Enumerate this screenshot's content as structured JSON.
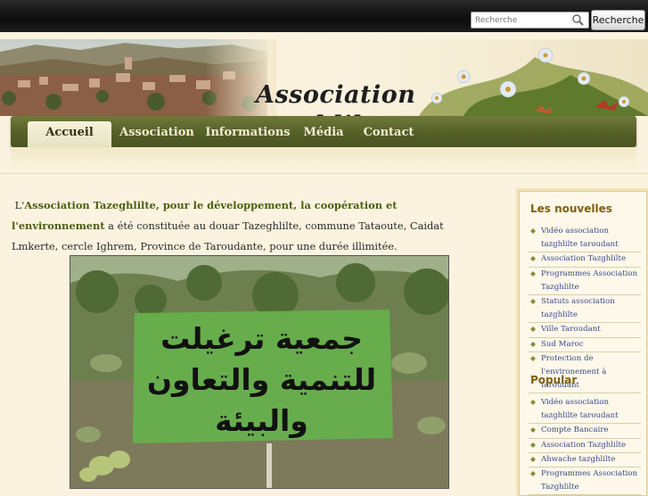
{
  "search": {
    "placeholder": "Recherche",
    "button_label": "Recherche"
  },
  "site": {
    "title_line1": "Association",
    "title_line2": "tazghlilte"
  },
  "nav": {
    "items": [
      {
        "label": "Accueil",
        "active": true
      },
      {
        "label": "Association",
        "active": false
      },
      {
        "label": "Informations",
        "active": false
      },
      {
        "label": "Média",
        "active": false
      },
      {
        "label": "Contact",
        "active": false
      }
    ]
  },
  "main": {
    "intro_prefix": "L'",
    "intro_highlight": "Association  Tazeghlilte, pour le développement, la coopération et l'environnement",
    "intro_text": " a été constituée au douar Tazeghlilte, commune Tataoute, Caidat Lmkerte, cercle Ighrem, Province de Taroudante, pour une durée illimitée.",
    "photo_banner_line1": "جمعية ترغيلت",
    "photo_banner_line2": "للتنمية والتعاون والبيئة"
  },
  "sidebar": {
    "news_heading": "Les nouvelles",
    "news_items": [
      "Vidéo association tazghlilte taroudant",
      "Association Tazghlilte",
      "Programmes Association Tazghlilte",
      "Statuts association tazghlilte",
      "Ville Taroudant",
      "Sud Maroc",
      "Protection de l'environement à taroudant"
    ],
    "popular_heading": "Popular",
    "popular_items": [
      "Vidéo association tazghlilte taroudant",
      "Compte Bancaire",
      "Association Tazghlilte",
      "Ahwache tazghlilte",
      "Programmes Association Tazghlilte"
    ]
  },
  "colors": {
    "nav_green": "#555f27",
    "highlight_green": "#4d5e12",
    "sidebar_heading": "#7f5f0b",
    "link_blue": "#3a4a8a"
  }
}
